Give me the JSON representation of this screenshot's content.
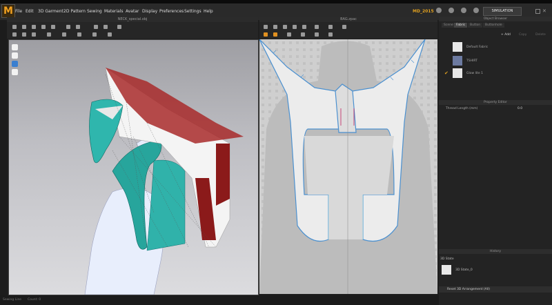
{
  "app": {
    "logo": "M"
  },
  "menu": [
    "File",
    "Edit",
    "3D Garment",
    "2D Pattern",
    "Sewing",
    "Materials",
    "Avatar",
    "Display",
    "Preferences",
    "Settings",
    "Help"
  ],
  "header": {
    "user": "MD_2015",
    "simulation_label": "SIMULATION"
  },
  "panels": {
    "view3d_title": "NECK_special.obj",
    "view2d_title": "BAG.zpac"
  },
  "object_browser": {
    "title": "Object Browser",
    "tabs": [
      "Scene",
      "Fabric",
      "Button",
      "Buttonhole"
    ],
    "active_tab": "Fabric",
    "actions": [
      "+ Add",
      "Copy",
      "Delete"
    ],
    "fabrics": [
      {
        "name": "Default Fabric",
        "color": "#e8e8e8",
        "checked": false
      },
      {
        "name": "TSHIRT",
        "color": "#6c7aa0",
        "checked": false
      },
      {
        "name": "Glow lite 1",
        "color": "#e6e6e6",
        "checked": true
      }
    ]
  },
  "property_editor": {
    "title": "Property Editor",
    "rows": [
      {
        "label": "Thread Length (mm)",
        "value": "0.0"
      }
    ]
  },
  "history": {
    "title": "History",
    "section": "3D State",
    "items": [
      "3D State_0"
    ],
    "footer": "Reset 3D Arrangement (All)"
  },
  "status": {
    "left": "Sewing Line",
    "right": "Count: 0"
  },
  "colors": {
    "accent": "#e09020",
    "seam": "#4a90d0",
    "garment_red": "#8b1a1a",
    "avatar_teal": "#2aa8a0"
  }
}
